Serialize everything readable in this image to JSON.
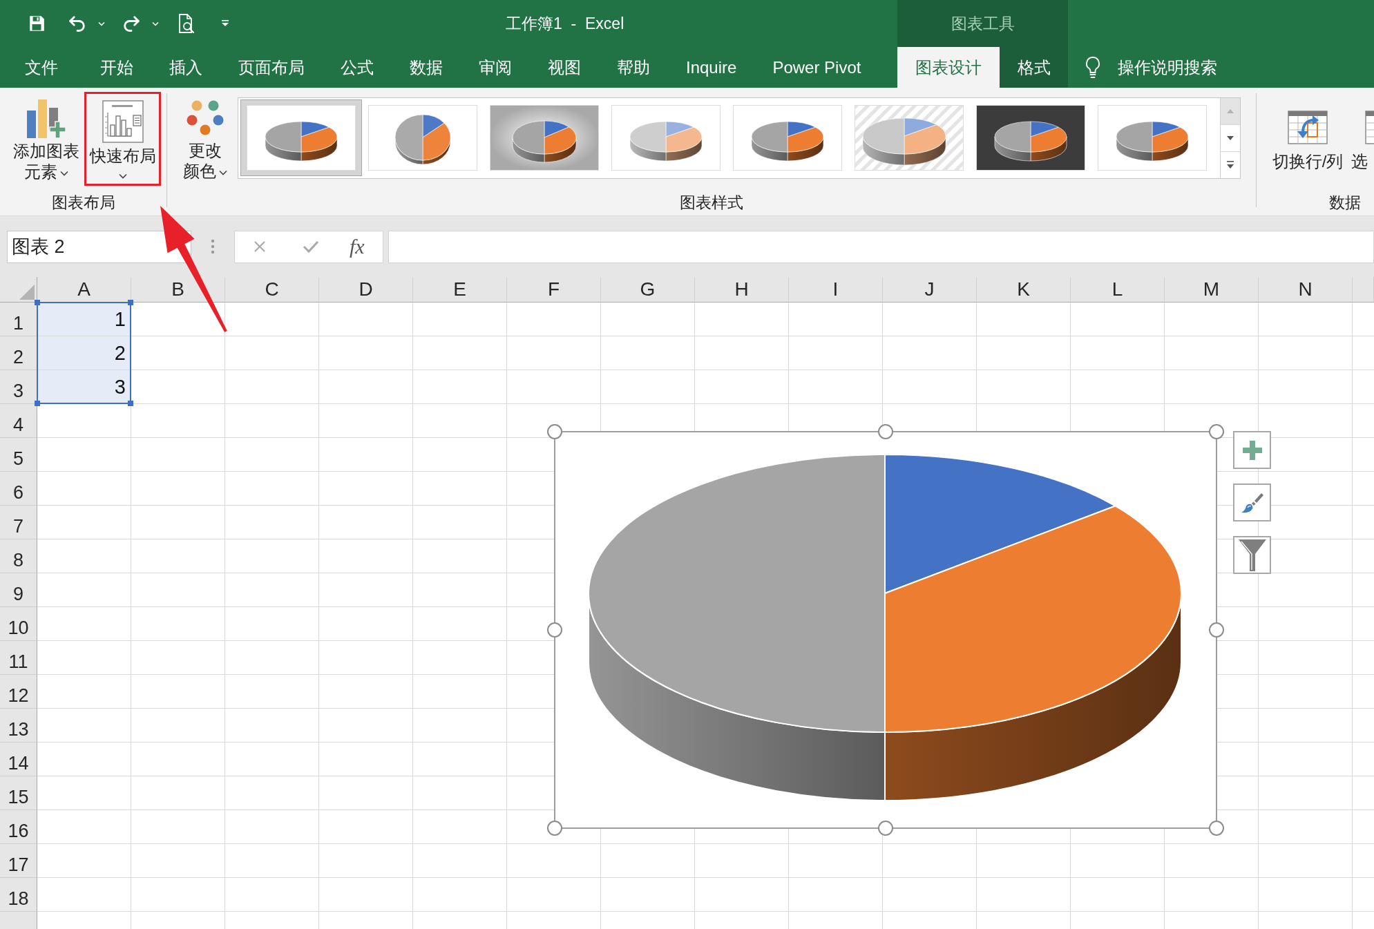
{
  "title_bar": {
    "title": "工作簿1  -  Excel"
  },
  "tabs": [
    {
      "label": "文件",
      "selected": false
    },
    {
      "label": "开始",
      "selected": false
    },
    {
      "label": "插入",
      "selected": false
    },
    {
      "label": "页面布局",
      "selected": false
    },
    {
      "label": "公式",
      "selected": false
    },
    {
      "label": "数据",
      "selected": false
    },
    {
      "label": "审阅",
      "selected": false
    },
    {
      "label": "视图",
      "selected": false
    },
    {
      "label": "帮助",
      "selected": false
    },
    {
      "label": "Inquire",
      "selected": false
    },
    {
      "label": "Power Pivot",
      "selected": false
    }
  ],
  "chart_tools": {
    "title": "图表工具",
    "tabs": [
      {
        "label": "图表设计",
        "selected": true
      },
      {
        "label": "格式",
        "selected": false
      }
    ]
  },
  "tell_me": {
    "placeholder": "操作说明搜索"
  },
  "ribbon": {
    "chart_layouts": {
      "label": "图表布局",
      "buttons": [
        {
          "label": "添加图表元素",
          "highlighted": false
        },
        {
          "label": "快速布局",
          "highlighted": true
        }
      ]
    },
    "chart_styles": {
      "label": "图表样式",
      "change_colors": {
        "label": "更改颜色"
      },
      "styles": [
        {
          "kind": "plain",
          "selected": true
        },
        {
          "kind": "upright",
          "selected": false
        },
        {
          "kind": "shaded",
          "selected": false
        },
        {
          "kind": "pastel",
          "selected": false
        },
        {
          "kind": "plain",
          "selected": false
        },
        {
          "kind": "striped",
          "selected": false
        },
        {
          "kind": "dark",
          "selected": false
        },
        {
          "kind": "plain",
          "selected": false
        }
      ],
      "scroll": [
        {
          "kind": "up",
          "disabled": true
        },
        {
          "kind": "down",
          "disabled": false
        },
        {
          "kind": "more",
          "disabled": false
        }
      ]
    },
    "data": {
      "label": "数据",
      "buttons": [
        {
          "label": "切换行/列"
        },
        {
          "label": "选"
        }
      ]
    }
  },
  "formula_bar": {
    "name_box": "图表 2",
    "edit_buttons": [
      {
        "kind": "cancel",
        "disabled": true
      },
      {
        "kind": "enter",
        "disabled": true
      }
    ],
    "function_label": "fx"
  },
  "sheet": {
    "columns": [
      "A",
      "B",
      "C",
      "D",
      "E",
      "F",
      "G",
      "H",
      "I",
      "J",
      "K",
      "L",
      "M",
      "N"
    ],
    "rows": [
      {
        "label": "1",
        "cells": [
          {
            "value": "1",
            "selected": true
          }
        ]
      },
      {
        "label": "2",
        "cells": [
          {
            "value": "2",
            "selected": true
          }
        ]
      },
      {
        "label": "3",
        "cells": [
          {
            "value": "3",
            "selected": true
          }
        ]
      },
      {
        "label": "4"
      },
      {
        "label": "5"
      },
      {
        "label": "6"
      },
      {
        "label": "7"
      },
      {
        "label": "8"
      },
      {
        "label": "9"
      },
      {
        "label": "10"
      },
      {
        "label": "11"
      },
      {
        "label": "12"
      },
      {
        "label": "13"
      },
      {
        "label": "14"
      },
      {
        "label": "15"
      },
      {
        "label": "16"
      },
      {
        "label": "17"
      },
      {
        "label": "18"
      }
    ]
  },
  "chart": {
    "selected": true,
    "slices": [
      {
        "color": "#4472c4"
      },
      {
        "color": "#ed7d31"
      },
      {
        "color": "#a5a5a5"
      }
    ]
  }
}
